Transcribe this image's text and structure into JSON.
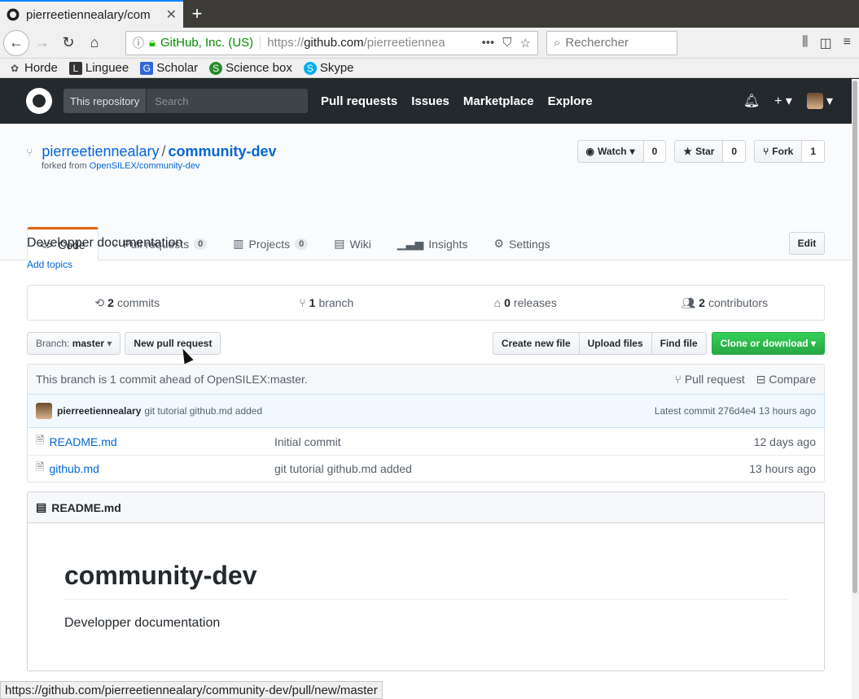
{
  "browser": {
    "tab_title": "pierreetiennealary/com",
    "url_identity": "GitHub, Inc. (US)",
    "url_prefix": "https://",
    "url_host": "github.com",
    "url_path": "/pierreetiennea",
    "search_placeholder": "Rechercher",
    "bookmarks": [
      "Horde",
      "Linguee",
      "Scholar",
      "Science box",
      "Skype"
    ],
    "status_url": "https://github.com/pierreetiennealary/community-dev/pull/new/master"
  },
  "header": {
    "scope_label": "This repository",
    "search_placeholder": "Search",
    "nav": [
      "Pull requests",
      "Issues",
      "Marketplace",
      "Explore"
    ]
  },
  "repo": {
    "owner": "pierreetiennealary",
    "separator": "/",
    "name": "community-dev",
    "forked_prefix": "forked from",
    "forked_link": "OpenSILEX/community-dev",
    "watch_label": "Watch",
    "watch_count": "0",
    "star_label": "Star",
    "star_count": "0",
    "fork_label": "Fork",
    "fork_count": "1",
    "tabs": [
      {
        "label": "Code",
        "count": ""
      },
      {
        "label": "Pull requests",
        "count": "0"
      },
      {
        "label": "Projects",
        "count": "0"
      },
      {
        "label": "Wiki",
        "count": ""
      },
      {
        "label": "Insights",
        "count": ""
      },
      {
        "label": "Settings",
        "count": ""
      }
    ],
    "description": "Developper documentation",
    "add_topics": "Add topics",
    "edit_label": "Edit"
  },
  "summary": {
    "commits_n": "2",
    "commits_l": "commits",
    "branch_n": "1",
    "branch_l": "branch",
    "releases_n": "0",
    "releases_l": "releases",
    "contrib_n": "2",
    "contrib_l": "contributors"
  },
  "filenav": {
    "branch_prefix": "Branch:",
    "branch_name": "master",
    "new_pr": "New pull request",
    "create_file": "Create new file",
    "upload_files": "Upload files",
    "find_file": "Find file",
    "clone": "Clone or download"
  },
  "branch_info": {
    "text": "This branch is 1 commit ahead of OpenSILEX:master.",
    "pull_request": "Pull request",
    "compare": "Compare"
  },
  "latest_commit": {
    "author": "pierreetiennealary",
    "message": "git tutorial github.md added",
    "label": "Latest commit",
    "sha": "276d4e4",
    "age": "13 hours ago"
  },
  "files": [
    {
      "name": "README.md",
      "message": "Initial commit",
      "age": "12 days ago"
    },
    {
      "name": "github.md",
      "message": "git tutorial github.md added",
      "age": "13 hours ago"
    }
  ],
  "readme": {
    "filename": "README.md",
    "heading": "community-dev",
    "body": "Developper documentation"
  },
  "colors": {
    "accent": "#0366d6",
    "header_bg": "#24292e",
    "green_button": "#28a745",
    "tab_accent": "#e36209"
  }
}
